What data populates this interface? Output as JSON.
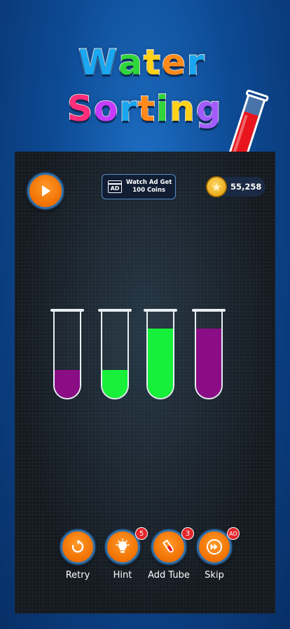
{
  "title": {
    "line1": [
      "W",
      "a",
      "t",
      "e",
      "r"
    ],
    "line1_colors": [
      "#1aa7f0",
      "#2fd63a",
      "#ffd21a",
      "#ff8a1a",
      "#1aa7f0"
    ],
    "line2": [
      "S",
      "o",
      "r",
      "t",
      "i",
      "n",
      "g"
    ],
    "line2_colors": [
      "#ff2d7a",
      "#c53bff",
      "#1aa7f0",
      "#ff8a1a",
      "#2fd63a",
      "#ffd21a",
      "#a35cff"
    ]
  },
  "header": {
    "watch_ad_icon": "AD",
    "watch_ad_line1": "Watch Ad Get",
    "watch_ad_line2": "100 Coins",
    "coins": "55,258"
  },
  "tubes": [
    {
      "color": "#8b0d86",
      "fill": 0.32
    },
    {
      "color": "#18f03a",
      "fill": 0.32
    },
    {
      "color": "#17f03a",
      "fill": 0.8
    },
    {
      "color": "#8b0d86",
      "fill": 0.8
    }
  ],
  "actions": {
    "retry": "Retry",
    "hint": "Hint",
    "hint_badge": "5",
    "add_tube": "Add Tube",
    "add_tube_badge": "3",
    "skip": "Skip",
    "skip_badge": "AD"
  },
  "colors": {
    "accent_orange": "#f07000",
    "badge_red": "#e2262b",
    "title_tube_red": "#e8151d"
  }
}
